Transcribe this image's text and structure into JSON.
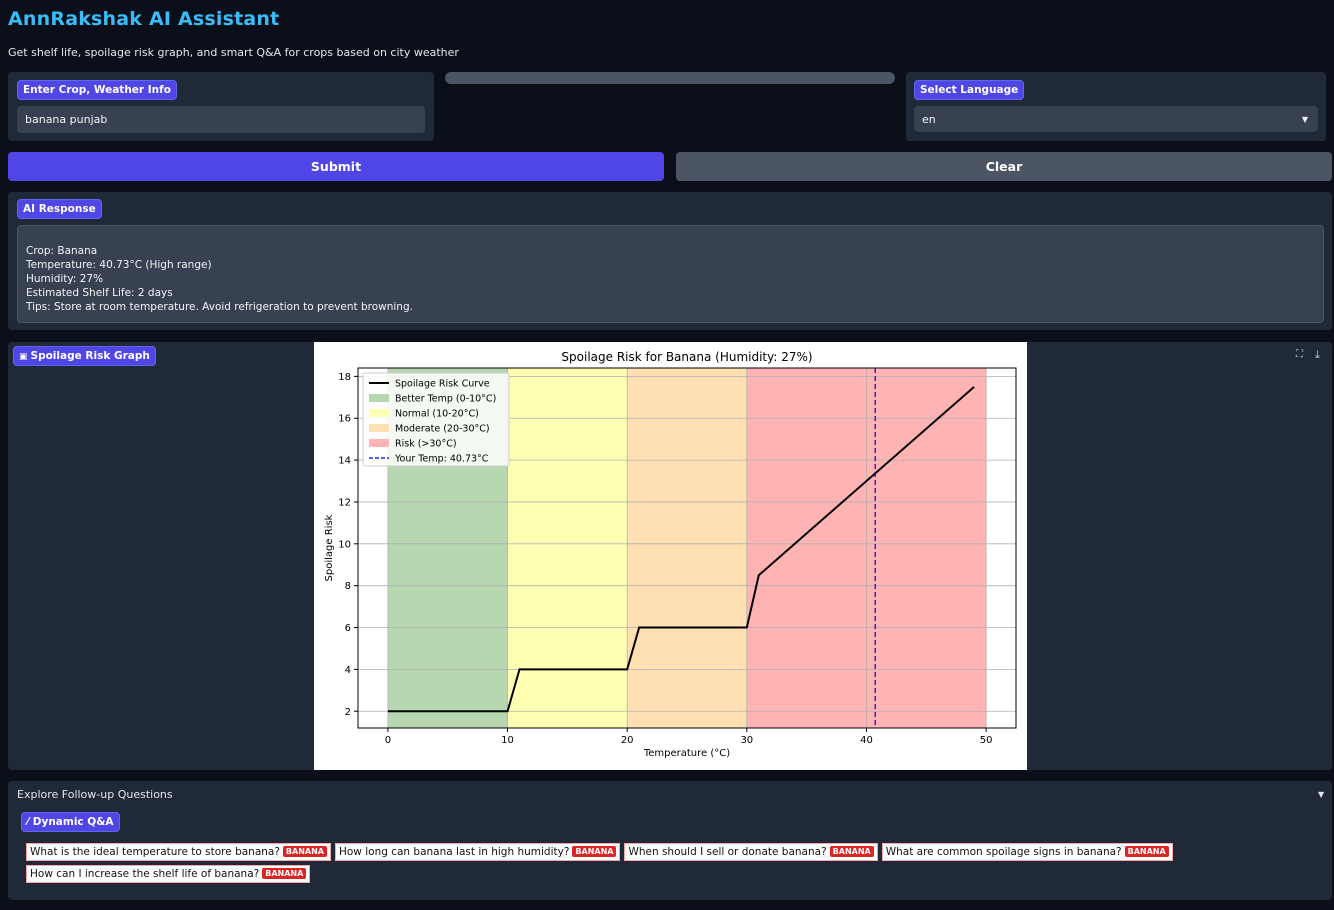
{
  "app": {
    "title": "AnnRakshak AI Assistant",
    "subtitle": "Get shelf life, spoilage risk graph, and smart Q&A for crops based on city weather"
  },
  "input": {
    "label": "Enter Crop, Weather Info",
    "value": "banana punjab"
  },
  "language": {
    "label": "Select Language",
    "selected": "en"
  },
  "buttons": {
    "submit": "Submit",
    "clear": "Clear"
  },
  "response": {
    "label": "AI Response",
    "lines": [
      "Crop: Banana",
      "Temperature: 40.73°C (High range)",
      "Humidity: 27%",
      "Estimated Shelf Life: 2 days",
      "Tips: Store at room temperature. Avoid refrigeration to prevent browning."
    ]
  },
  "graph": {
    "label": "Spoilage Risk Graph",
    "icons": [
      "fullscreen-icon",
      "download-icon"
    ]
  },
  "chart_data": {
    "type": "line",
    "title": "Spoilage Risk for Banana (Humidity: 27%)",
    "xlabel": "Temperature (°C)",
    "ylabel": "Spoilage Risk",
    "xlim": [
      -2.5,
      52.5
    ],
    "ylim": [
      1.2,
      18.4
    ],
    "xticks": [
      0,
      10,
      20,
      30,
      40,
      50
    ],
    "yticks": [
      2,
      4,
      6,
      8,
      10,
      12,
      14,
      16,
      18
    ],
    "grid": true,
    "legend_position": "top-left",
    "series": [
      {
        "name": "Spoilage Risk Curve",
        "color": "#000000",
        "x": [
          0,
          10,
          11,
          20,
          21,
          30,
          31,
          49
        ],
        "y": [
          2,
          2,
          4,
          4,
          6,
          6,
          8.5,
          17.5
        ]
      }
    ],
    "zones": [
      {
        "name": "Better Temp (0-10°C)",
        "from": 0,
        "to": 10,
        "color": "#b6d7b0"
      },
      {
        "name": "Normal (10-20°C)",
        "from": 10,
        "to": 20,
        "color": "#ffffb3"
      },
      {
        "name": "Moderate (20-30°C)",
        "from": 20,
        "to": 30,
        "color": "#ffe0b3"
      },
      {
        "name": "Risk (>30°C)",
        "from": 30,
        "to": 50,
        "color": "#ffb3b3"
      }
    ],
    "marker": {
      "name": "Your Temp: 40.73°C",
      "x": 40.73,
      "color": "#0000cc",
      "style": "dashed"
    }
  },
  "followup": {
    "accordion_title": "Explore Follow-up Questions",
    "label": "Dynamic Q&A",
    "questions": [
      {
        "text": "What is the ideal temperature to store banana?",
        "tag": "BANANA"
      },
      {
        "text": "How long can banana last in high humidity?",
        "tag": "BANANA"
      },
      {
        "text": "When should I sell or donate banana?",
        "tag": "BANANA"
      },
      {
        "text": "What are common spoilage signs in banana?",
        "tag": "BANANA"
      },
      {
        "text": "How can I increase the shelf life of banana?",
        "tag": "BANANA"
      }
    ]
  }
}
